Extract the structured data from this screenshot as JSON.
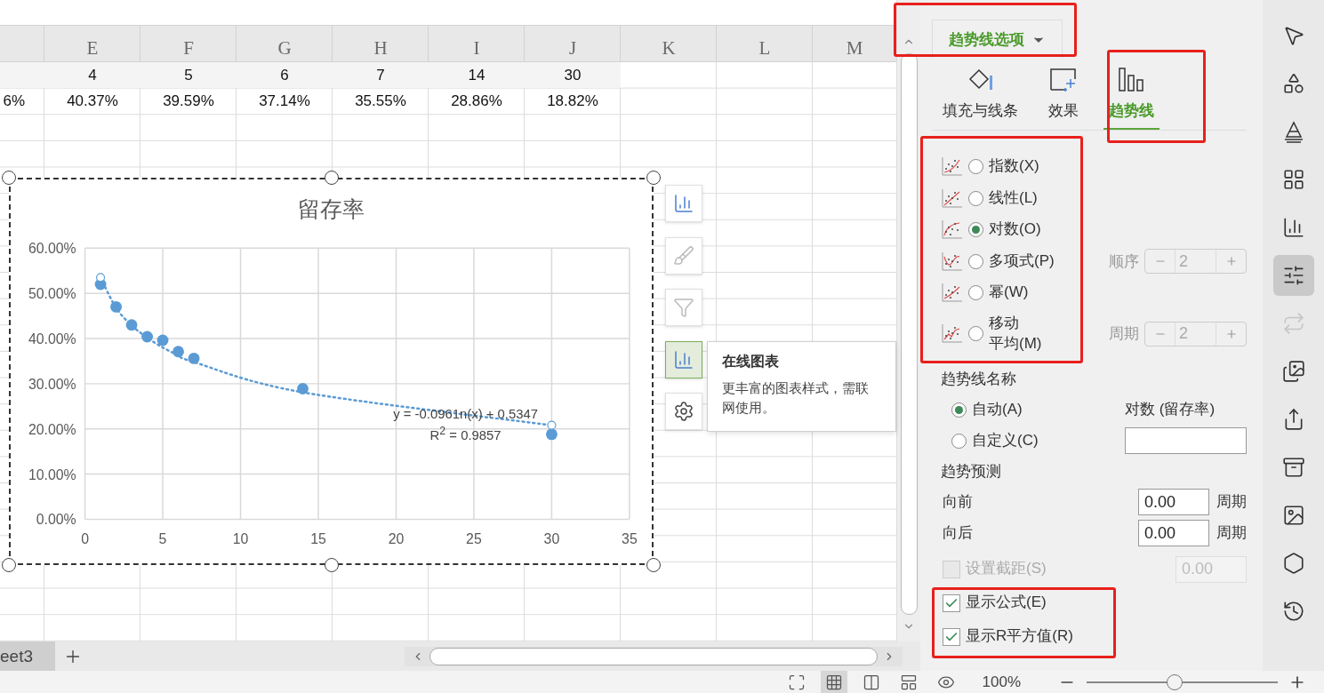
{
  "sheet": {
    "columns": [
      "E",
      "F",
      "G",
      "H",
      "I",
      "J",
      "K",
      "L",
      "M"
    ],
    "rows": [
      {
        "shaded": true,
        "cells": [
          "4",
          "5",
          "6",
          "7",
          "14",
          "30"
        ]
      },
      {
        "shaded": false,
        "lead": "6%",
        "cells": [
          "40.37%",
          "39.59%",
          "37.14%",
          "35.55%",
          "28.86%",
          "18.82%"
        ]
      }
    ]
  },
  "chart": {
    "selected": true,
    "chart_data": {
      "type": "scatter",
      "title": "留存率",
      "x": [
        1,
        2,
        3,
        4,
        5,
        6,
        7,
        14,
        30
      ],
      "series": [
        {
          "color": "#5b9bd5",
          "values": [
            0.52,
            0.47,
            0.43,
            0.404,
            0.396,
            0.371,
            0.356,
            0.289,
            0.188
          ]
        },
        {
          "type": "line",
          "line_style": "dotted",
          "color": "#5b9bd5",
          "values": [
            0.535,
            0.468,
            0.429,
            0.402,
            0.38,
            0.363,
            0.348,
            0.281,
            0.208
          ]
        }
      ],
      "xlim": [
        0,
        35
      ],
      "ylim": [
        0,
        0.6
      ],
      "xticks": [
        {
          "value": 0,
          "label": "0"
        },
        {
          "value": 5,
          "label": "5"
        },
        {
          "value": 10,
          "label": "10"
        },
        {
          "value": 15,
          "label": "15"
        },
        {
          "value": 20,
          "label": "20"
        },
        {
          "value": 25,
          "label": "25"
        },
        {
          "value": 30,
          "label": "30"
        },
        {
          "value": 35,
          "label": "35"
        }
      ],
      "yticks": [
        {
          "value": 0,
          "label": "0.00%"
        },
        {
          "value": 0.1,
          "label": "10.00%"
        },
        {
          "value": 0.2,
          "label": "20.00%"
        },
        {
          "value": 0.3,
          "label": "30.00%"
        },
        {
          "value": 0.4,
          "label": "40.00%"
        },
        {
          "value": 0.5,
          "label": "50.00%"
        },
        {
          "value": 0.6,
          "label": "60.00%"
        }
      ],
      "grid": true,
      "annotations": [
        {
          "text": "y = -0.0961n(x) + 0.5347"
        },
        {
          "text": "R$^{2}$ = 0.9857"
        }
      ]
    }
  },
  "chart_tools": [
    {
      "kind": "elements",
      "selected": false
    },
    {
      "kind": "style",
      "selected": false
    },
    {
      "kind": "filter",
      "selected": false
    },
    {
      "kind": "online",
      "selected": true
    },
    {
      "kind": "settings",
      "selected": false
    }
  ],
  "tooltip": {
    "title": "在线图表",
    "body": "更丰富的图表样式，需联网使用。"
  },
  "sheet_tabs": [
    {
      "label": "eet3"
    }
  ],
  "panel": {
    "dropdown": "趋势线选项",
    "tabs": [
      {
        "kind": "fill",
        "label": "填充与线条",
        "selected": false
      },
      {
        "kind": "effects",
        "label": "效果",
        "selected": false
      },
      {
        "kind": "trendline",
        "label": "趋势线",
        "selected": true
      }
    ],
    "trend_types": [
      {
        "kind": "exponential",
        "label": "指数(X)",
        "selected": false
      },
      {
        "kind": "linear",
        "label": "线性(L)",
        "selected": false
      },
      {
        "kind": "logarithmic",
        "label": "对数(O)",
        "selected": true
      },
      {
        "kind": "polynomial",
        "label": "多项式(P)",
        "selected": false,
        "stepper": {
          "label": "顺序",
          "value": "2",
          "disabled": true
        }
      },
      {
        "kind": "power",
        "label": "幂(W)",
        "selected": false
      },
      {
        "kind": "moving",
        "label": "移动平均(M)",
        "selected": false,
        "wrapped": true,
        "stepper": {
          "label": "周期",
          "value": "2",
          "disabled": true
        }
      }
    ],
    "name_heading": "趋势线名称",
    "name_options": [
      {
        "label": "自动(A)",
        "selected": true,
        "value": "对数 (留存率)"
      },
      {
        "label": "自定义(C)",
        "selected": false
      }
    ],
    "forecast_heading": "趋势预测",
    "forecast": [
      {
        "label": "向前",
        "value": "0.00",
        "unit": "周期"
      },
      {
        "label": "向后",
        "value": "0.00",
        "unit": "周期"
      }
    ],
    "options": [
      {
        "label": "设置截距(S)",
        "checked": false,
        "disabled": true,
        "value": "0.00"
      },
      {
        "label": "显示公式(E)",
        "checked": true,
        "disabled": false
      },
      {
        "label": "显示R平方值(R)",
        "checked": true,
        "disabled": false
      }
    ]
  },
  "toolbar": [
    {
      "kind": "cursor",
      "selected": false,
      "disabled": false
    },
    {
      "kind": "shapes",
      "selected": false,
      "disabled": false
    },
    {
      "kind": "text-fill",
      "selected": false,
      "disabled": false
    },
    {
      "kind": "grid",
      "selected": false,
      "disabled": false
    },
    {
      "kind": "chart",
      "selected": false,
      "disabled": false
    },
    {
      "kind": "sliders",
      "selected": true,
      "disabled": false
    },
    {
      "kind": "swap",
      "selected": false,
      "disabled": true
    },
    {
      "kind": "images",
      "selected": false,
      "disabled": false
    },
    {
      "kind": "share",
      "selected": false,
      "disabled": false
    },
    {
      "kind": "archive",
      "selected": false,
      "disabled": false
    },
    {
      "kind": "image",
      "selected": false,
      "disabled": false
    },
    {
      "kind": "hexagon",
      "selected": false,
      "disabled": false
    },
    {
      "kind": "history",
      "selected": false,
      "disabled": false
    }
  ],
  "status_bar": {
    "views": [
      {
        "kind": "fullscreen",
        "selected": false
      },
      {
        "kind": "normal",
        "selected": true
      },
      {
        "kind": "page-layout",
        "selected": false
      },
      {
        "kind": "page-break",
        "selected": false
      },
      {
        "kind": "eye",
        "selected": false
      }
    ],
    "zoom": "100%",
    "zoom_slider": {
      "level": 0.46
    }
  },
  "highlight_frames": {
    "dropdown": true,
    "trendline_tab": true,
    "trend_types": true,
    "display_options": true
  }
}
